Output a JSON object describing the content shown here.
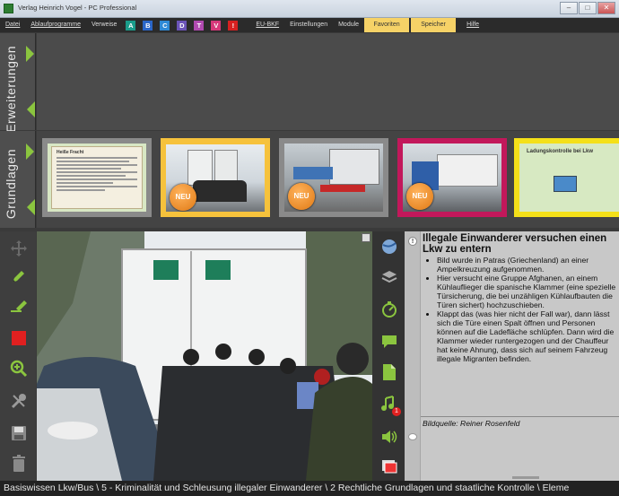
{
  "window": {
    "title": "Verlag Heinrich Vogel - PC Professional"
  },
  "menu": {
    "items": [
      "Datei",
      "Ablaufprogramme",
      "Verweise"
    ],
    "verweise": [
      {
        "label": "A",
        "color": "#1a9c8a"
      },
      {
        "label": "B",
        "color": "#2a66c8"
      },
      {
        "label": "C",
        "color": "#2f8ad6"
      },
      {
        "label": "D",
        "color": "#6b54b8"
      },
      {
        "label": "T",
        "color": "#b04ab0"
      },
      {
        "label": "V",
        "color": "#d6387a"
      },
      {
        "label": "!",
        "color": "#d62020"
      }
    ],
    "items2": [
      "EU-BKF",
      "Einstellungen",
      "Module"
    ],
    "favoriten": "Favoriten",
    "speicher": "Speicher",
    "hilfe": "Hilfe"
  },
  "panels": {
    "erweiterungen": "Erweiterungen",
    "grundlagen": "Grundlagen"
  },
  "thumbs": {
    "doc_title": "Heiße Fracht",
    "badge": "NEU",
    "last_title": "Ladungskontrolle bei Lkw",
    "colors": {
      "selected": "#f6c23c",
      "magenta": "#c2185b",
      "yellow": "#f4e019",
      "gray": "#8a8a8a"
    }
  },
  "content": {
    "title": "Illegale Einwanderer versuchen einen Lkw zu entern",
    "bullets": [
      "Bild wurde in Patras (Griechenland) an einer Ampelkreuzung aufgenommen.",
      "Hier versucht eine Gruppe Afghanen, an einem Kühlauflieger die spanische Klammer (eine spezielle Türsicherung, die bei unzähligen Kühlaufbauten die Türen sichert) hochzuschieben.",
      "Klappt das (was hier nicht der Fall war), dann lässt sich die Türe einen Spalt öffnen und Personen können auf die Ladefläche schlüpfen. Dann wird die Klammer wieder runtergezogen und der Chauffeur hat keine Ahnung, dass sich auf seinem Fahrzeug illegale Migranten befinden."
    ],
    "source": "Bildquelle: Reiner Rosenfeld"
  },
  "badge_count": "1",
  "status": "Basiswissen Lkw/Bus \\ 5 - Kriminalität und Schleusung illegaler Einwanderer \\ 2 Rechtliche Grundlagen und staatliche Kontrolle  \\ Eleme"
}
